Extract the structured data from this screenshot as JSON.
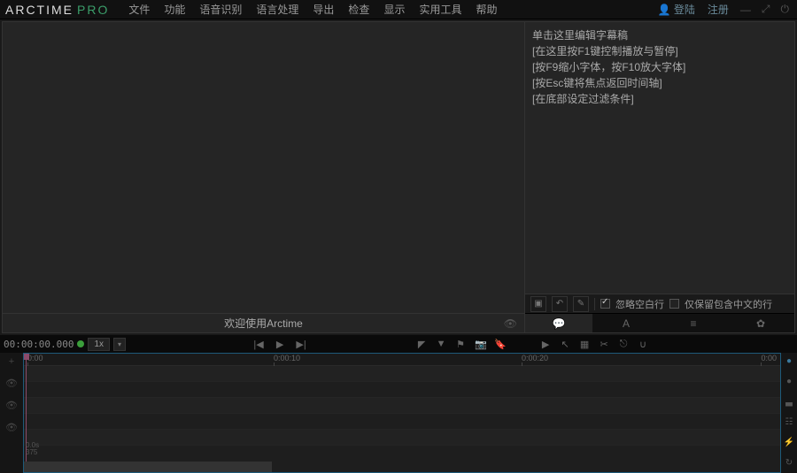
{
  "logo": {
    "arc": "ARCTIME",
    "pro": "PRO"
  },
  "menus": [
    "文件",
    "功能",
    "语音识别",
    "语言处理",
    "导出",
    "检查",
    "显示",
    "实用工具",
    "帮助"
  ],
  "auth": {
    "login": "登陆",
    "register": "注册"
  },
  "video": {
    "status": "欢迎使用Arctime"
  },
  "script": {
    "placeholder_lines": [
      "单击这里编辑字幕稿",
      "[在这里按F1键控制播放与暂停]",
      "[按F9缩小字体，按F10放大字体]",
      "[按Esc键将焦点返回时间轴]",
      "[在底部设定过滤条件]"
    ],
    "chk_ignore_blank": "忽略空白行",
    "chk_cn_only": "仅保留包含中文的行"
  },
  "timeline": {
    "timecode": "00:00:00.000",
    "rate": "1x",
    "ticks": [
      "0:00",
      "0:00:10",
      "0:00:20",
      "0:00"
    ],
    "bottom_a": "0.0s",
    "bottom_b": "375"
  }
}
